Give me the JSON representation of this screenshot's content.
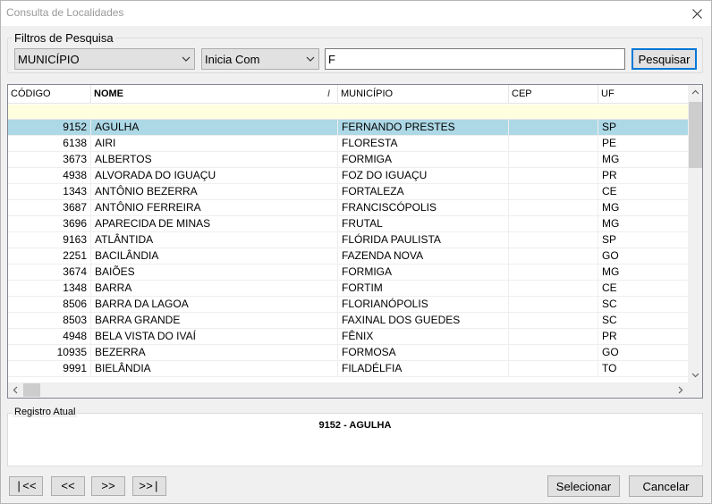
{
  "window": {
    "title": "Consulta de Localidades"
  },
  "filters": {
    "legend": "Filtros de Pesquisa",
    "field_value": "MUNICÍPIO",
    "mode_value": "Inicia Com",
    "search_value": "F",
    "search_button": "Pesquisar"
  },
  "grid": {
    "columns": [
      "CÓDIGO",
      "NOME",
      "MUNICÍPIO",
      "CEP",
      "UF"
    ],
    "sort_indicator": "/",
    "rows": [
      {
        "code": "9152",
        "nome": "AGULHA",
        "municipio": "FERNANDO PRESTES",
        "cep": "",
        "uf": "SP"
      },
      {
        "code": "6138",
        "nome": "AIRI",
        "municipio": "FLORESTA",
        "cep": "",
        "uf": "PE"
      },
      {
        "code": "3673",
        "nome": "ALBERTOS",
        "municipio": "FORMIGA",
        "cep": "",
        "uf": "MG"
      },
      {
        "code": "4938",
        "nome": "ALVORADA DO IGUAÇU",
        "municipio": "FOZ DO IGUAÇU",
        "cep": "",
        "uf": "PR"
      },
      {
        "code": "1343",
        "nome": "ANTÔNIO BEZERRA",
        "municipio": "FORTALEZA",
        "cep": "",
        "uf": "CE"
      },
      {
        "code": "3687",
        "nome": "ANTÔNIO FERREIRA",
        "municipio": "FRANCISCÓPOLIS",
        "cep": "",
        "uf": "MG"
      },
      {
        "code": "3696",
        "nome": "APARECIDA DE MINAS",
        "municipio": "FRUTAL",
        "cep": "",
        "uf": "MG"
      },
      {
        "code": "9163",
        "nome": "ATLÂNTIDA",
        "municipio": "FLÓRIDA PAULISTA",
        "cep": "",
        "uf": "SP"
      },
      {
        "code": "2251",
        "nome": "BACILÂNDIA",
        "municipio": "FAZENDA NOVA",
        "cep": "",
        "uf": "GO"
      },
      {
        "code": "3674",
        "nome": "BAIÕES",
        "municipio": "FORMIGA",
        "cep": "",
        "uf": "MG"
      },
      {
        "code": "1348",
        "nome": "BARRA",
        "municipio": "FORTIM",
        "cep": "",
        "uf": "CE"
      },
      {
        "code": "8506",
        "nome": "BARRA DA LAGOA",
        "municipio": "FLORIANÓPOLIS",
        "cep": "",
        "uf": "SC"
      },
      {
        "code": "8503",
        "nome": "BARRA GRANDE",
        "municipio": "FAXINAL DOS GUEDES",
        "cep": "",
        "uf": "SC"
      },
      {
        "code": "4948",
        "nome": "BELA VISTA DO IVAÍ",
        "municipio": "FÊNIX",
        "cep": "",
        "uf": "PR"
      },
      {
        "code": "10935",
        "nome": "BEZERRA",
        "municipio": "FORMOSA",
        "cep": "",
        "uf": "GO"
      },
      {
        "code": "9991",
        "nome": "BIELÂNDIA",
        "municipio": "FILADÉLFIA",
        "cep": "",
        "uf": "TO"
      }
    ],
    "selected_index": 0
  },
  "current_record": {
    "legend": "Registro Atual",
    "value": "9152 - AGULHA"
  },
  "navigation": {
    "first": "|<<",
    "prev": "<<",
    "next": ">>",
    "last": ">>|"
  },
  "actions": {
    "select": "Selecionar",
    "cancel": "Cancelar"
  },
  "icons": {
    "close": "close-icon",
    "dropdown": "chevron-down-icon",
    "scroll_up": "chevron-up-icon",
    "scroll_down": "chevron-down-icon",
    "scroll_left": "chevron-left-icon",
    "scroll_right": "chevron-right-icon"
  },
  "colors": {
    "selected_row": "#add8e6",
    "filter_row": "#ffffe0",
    "focus_border": "#0078d7"
  }
}
